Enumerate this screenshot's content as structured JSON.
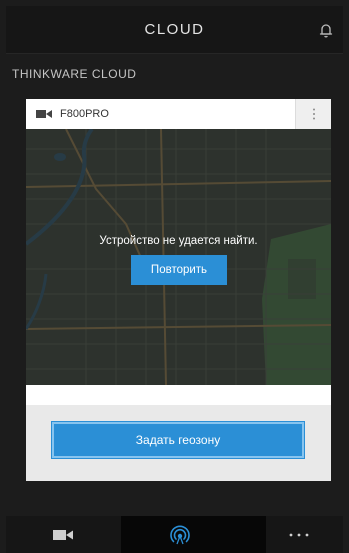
{
  "header": {
    "title": "CLOUD",
    "notification_icon": "bell-icon"
  },
  "section": {
    "title": "THINKWARE CLOUD"
  },
  "device_card": {
    "device_icon": "camera-icon",
    "device_name": "F800PRO",
    "menu_icon": "more-vertical-icon",
    "status_message": "Устройство не удается найти.",
    "retry_label": "Повторить",
    "geofence_label": "Задать геозону"
  },
  "bottom_nav": {
    "items": [
      {
        "icon": "video-camera-icon",
        "active": false
      },
      {
        "icon": "cloud-signal-icon",
        "active": true
      },
      {
        "icon": "more-horizontal-icon",
        "active": false
      }
    ]
  },
  "colors": {
    "accent": "#2b8fd6",
    "background": "#1c1c1c",
    "bar": "#161616"
  }
}
